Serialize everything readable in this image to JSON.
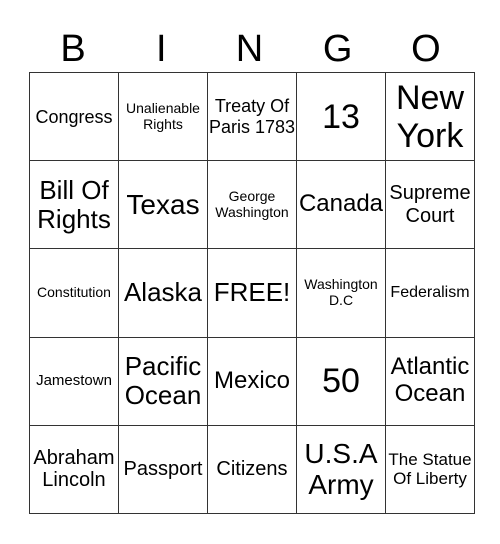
{
  "header": [
    "B",
    "I",
    "N",
    "G",
    "O"
  ],
  "cells": [
    [
      "Congress",
      "Unalienable Rights",
      "Treaty Of Paris 1783",
      "13",
      "New York"
    ],
    [
      "Bill Of Rights",
      "Texas",
      "George Washington",
      "Canada",
      "Supreme Court"
    ],
    [
      "Constitution",
      "Alaska",
      "FREE!",
      "Washington D.C",
      "Federalism"
    ],
    [
      "Jamestown",
      "Pacific Ocean",
      "Mexico",
      "50",
      "Atlantic Ocean"
    ],
    [
      "Abraham Lincoln",
      "Passport",
      "Citizens",
      "U.S.A Army",
      "The Statue Of Liberty"
    ]
  ]
}
